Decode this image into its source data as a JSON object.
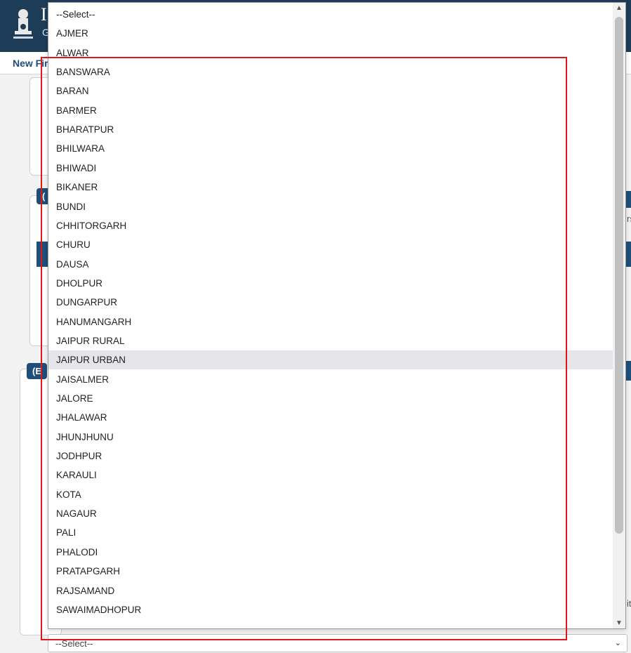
{
  "header": {
    "brand_initial": "I",
    "brand_sub": "G",
    "emblem": "india-emblem-icon"
  },
  "navbar": {
    "link_label": "New Fir"
  },
  "background": {
    "section_tags": [
      "(",
      "(E"
    ],
    "side_marks": [
      "rs",
      "it"
    ]
  },
  "district_select": {
    "options": [
      "--Select--",
      "AJMER",
      "ALWAR",
      "BANSWARA",
      "BARAN",
      "BARMER",
      "BHARATPUR",
      "BHILWARA",
      "BHIWADI",
      "BIKANER",
      "BUNDI",
      "CHHITORGARH",
      "CHURU",
      "DAUSA",
      "DHOLPUR",
      "DUNGARPUR",
      "HANUMANGARH",
      "JAIPUR RURAL",
      "JAIPUR URBAN",
      "JAISALMER",
      "JALORE",
      "JHALAWAR",
      "JHUNJHUNU",
      "JODHPUR",
      "KARAULI",
      "KOTA",
      "NAGAUR",
      "PALI",
      "PHALODI",
      "PRATAPGARH",
      "RAJSAMAND",
      "SAWAIMADHOPUR"
    ],
    "highlighted": "JAIPUR URBAN",
    "scroll_up_icon": "chevron-up-icon",
    "scroll_down_icon": "chevron-down-icon"
  },
  "next_select": {
    "value": "--Select--",
    "icon": "chevron-down-icon"
  },
  "colors": {
    "header_bg": "#1d3c57",
    "accent_blue": "#1f4e79",
    "highlight_red": "#e0161b",
    "option_hover": "#e5e5ea"
  }
}
